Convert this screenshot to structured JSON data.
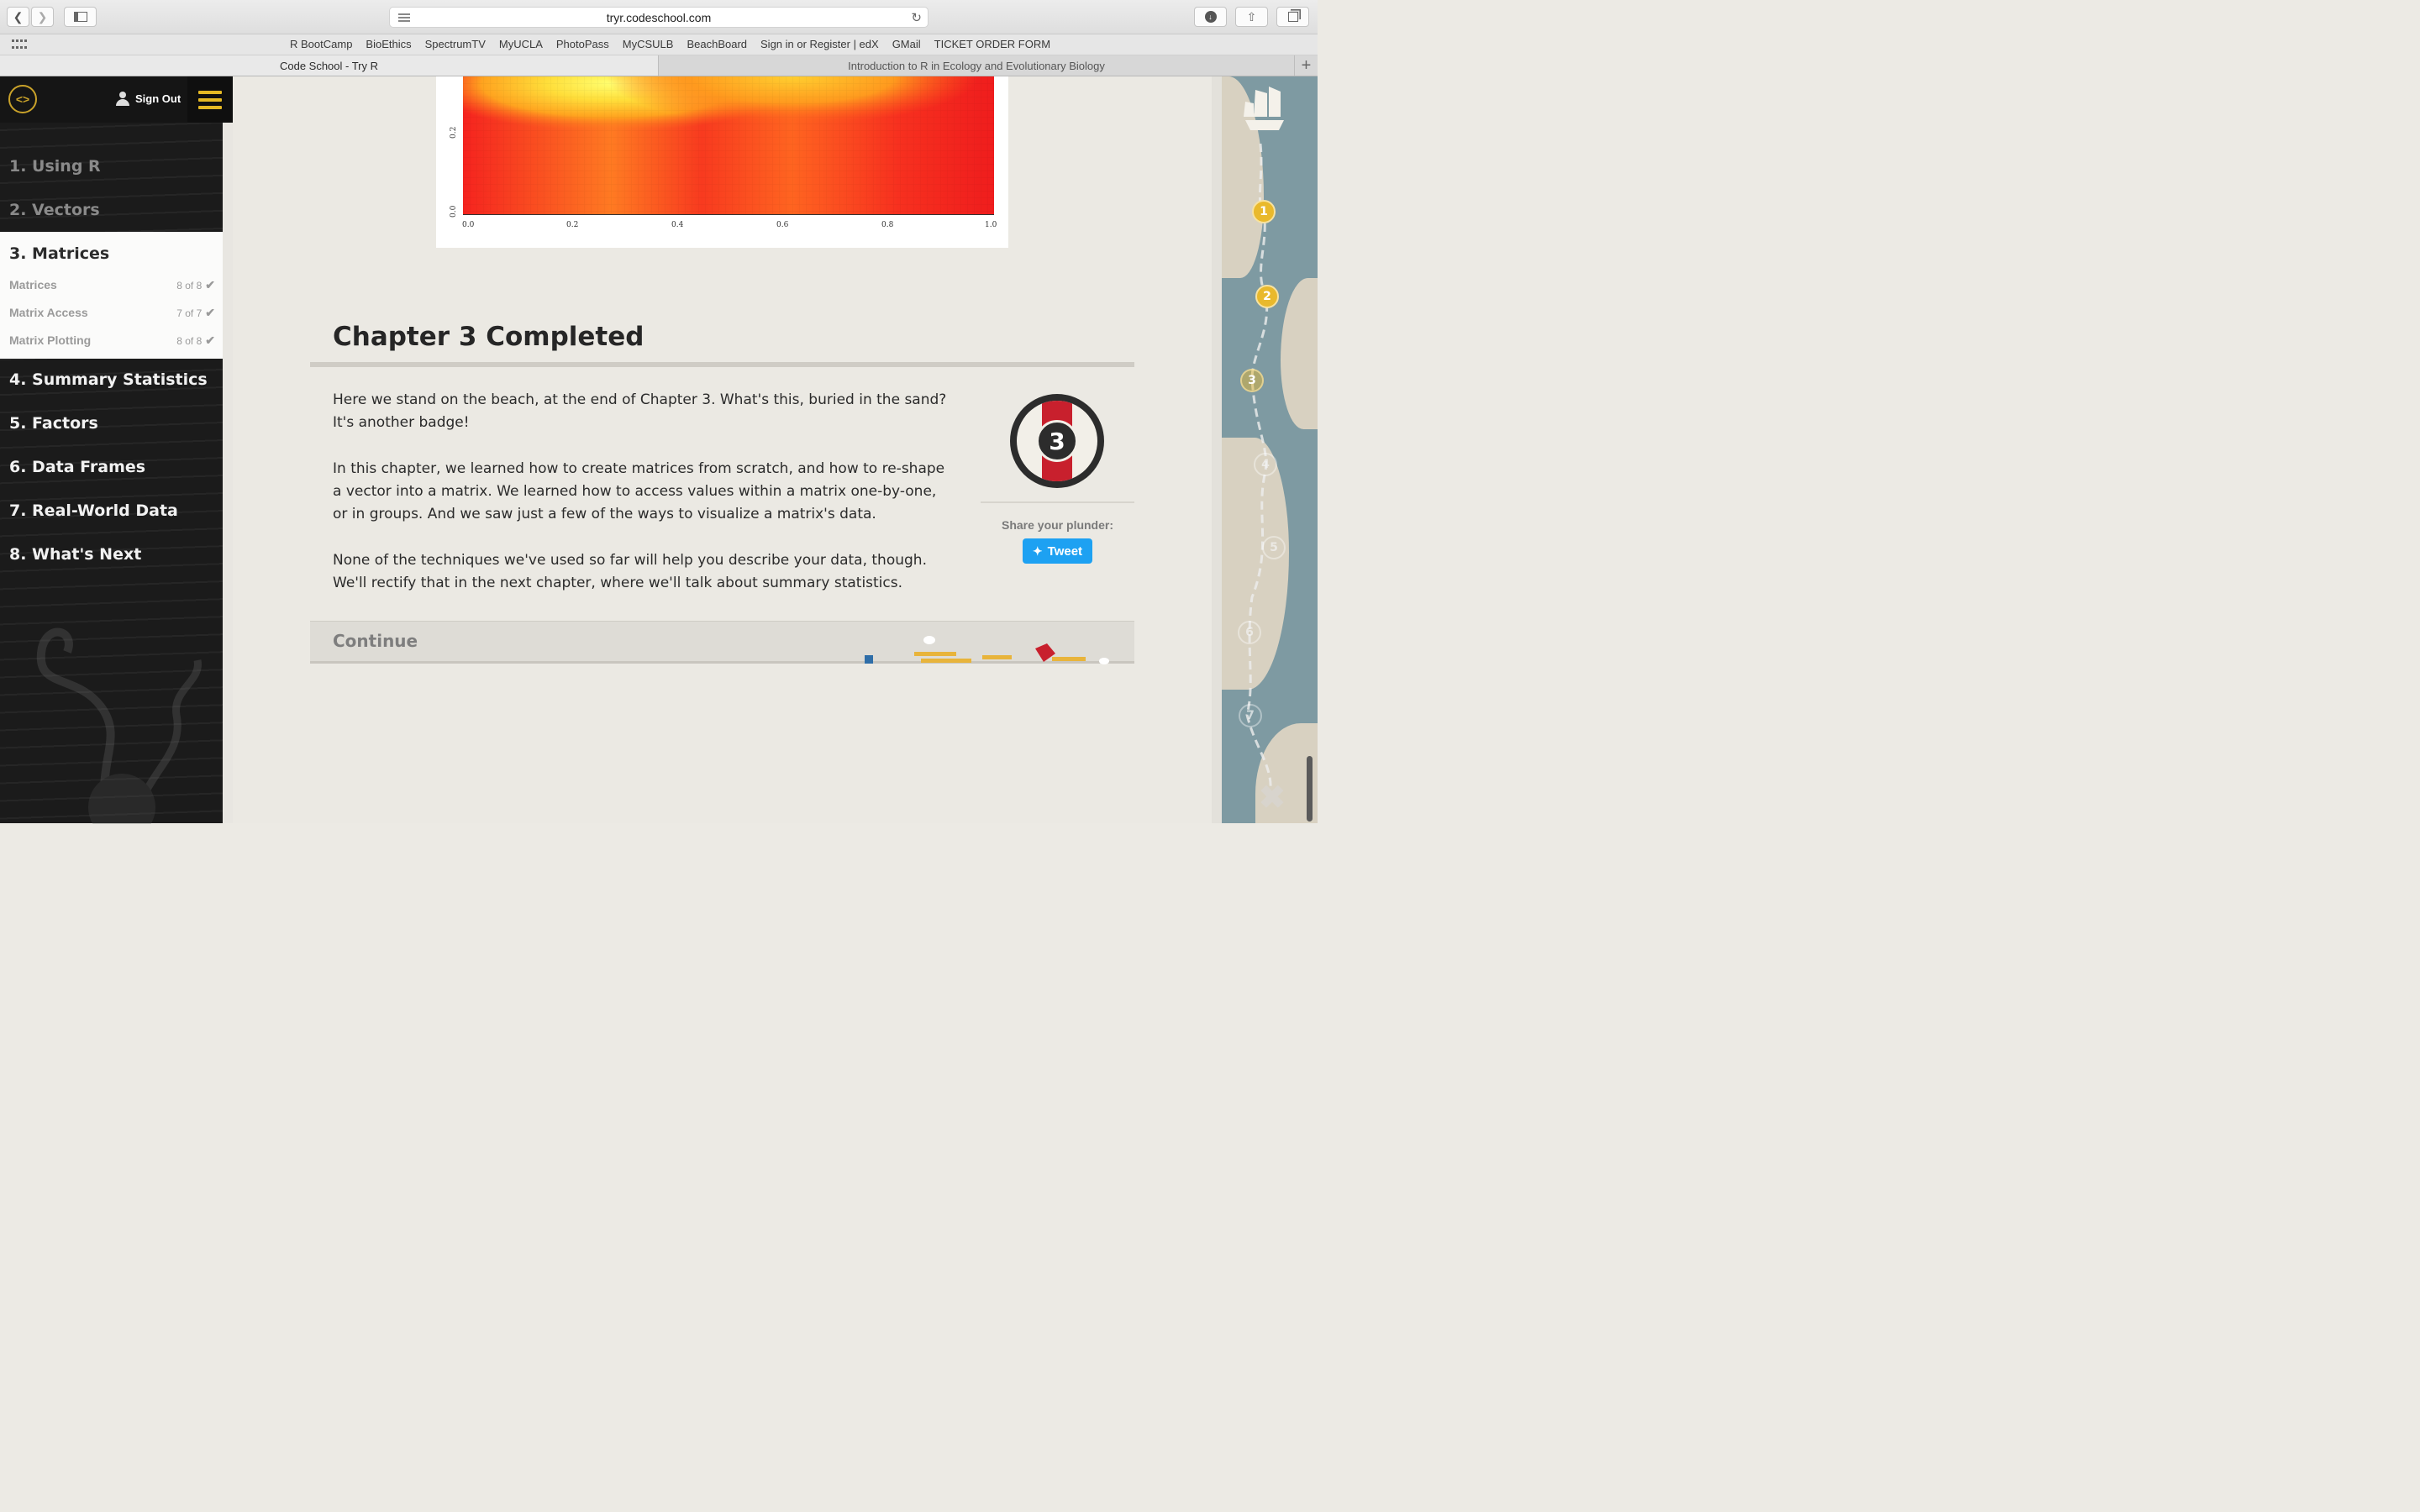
{
  "browser": {
    "url": "tryr.codeschool.com",
    "bookmarks": [
      "R BootCamp",
      "BioEthics",
      "SpectrumTV",
      "MyUCLA",
      "PhotoPass",
      "MyCSULB",
      "BeachBoard",
      "Sign in or Register | edX",
      "GMail",
      "TICKET ORDER FORM"
    ],
    "tabs": [
      {
        "title": "Code School - Try R",
        "active": true
      },
      {
        "title": "Introduction to R in Ecology and Evolutionary Biology",
        "active": false
      }
    ]
  },
  "sidebar": {
    "sign_out": "Sign Out",
    "chapters": [
      {
        "label": "1. Using R"
      },
      {
        "label": "2. Vectors"
      },
      {
        "label": "3. Matrices"
      },
      {
        "label": "4. Summary Statistics"
      },
      {
        "label": "5. Factors"
      },
      {
        "label": "6. Data Frames"
      },
      {
        "label": "7. Real-World Data"
      },
      {
        "label": "8. What's Next"
      }
    ],
    "lessons": [
      {
        "label": "Matrices",
        "count": "8 of 8"
      },
      {
        "label": "Matrix Access",
        "count": "7 of 7"
      },
      {
        "label": "Matrix Plotting",
        "count": "8 of 8"
      }
    ]
  },
  "plot": {
    "y_ticks": [
      "0.2",
      "0.0"
    ],
    "x_ticks": [
      "0.0",
      "0.2",
      "0.4",
      "0.6",
      "0.8",
      "1.0"
    ]
  },
  "content": {
    "title": "Chapter 3 Completed",
    "para1": "Here we stand on the beach, at the end of Chapter 3. What's this, buried in the sand? It's another badge!",
    "para2": "In this chapter, we learned how to create matrices from scratch, and how to re-shape a vector into a matrix. We learned how to access values within a matrix one-by-one, or in groups. And we saw just a few of the ways to visualize a matrix's data.",
    "para3": "None of the techniques we've used so far will help you describe your data, though. We'll rectify that in the next chapter, where we'll talk about summary statistics.",
    "badge_number": "3",
    "share_label": "Share your plunder:",
    "tweet_label": "Tweet",
    "continue_label": "Continue"
  },
  "map": {
    "markers": [
      "1",
      "2",
      "3",
      "4",
      "5",
      "6",
      "7"
    ],
    "accent_color": "#e9b92c"
  }
}
